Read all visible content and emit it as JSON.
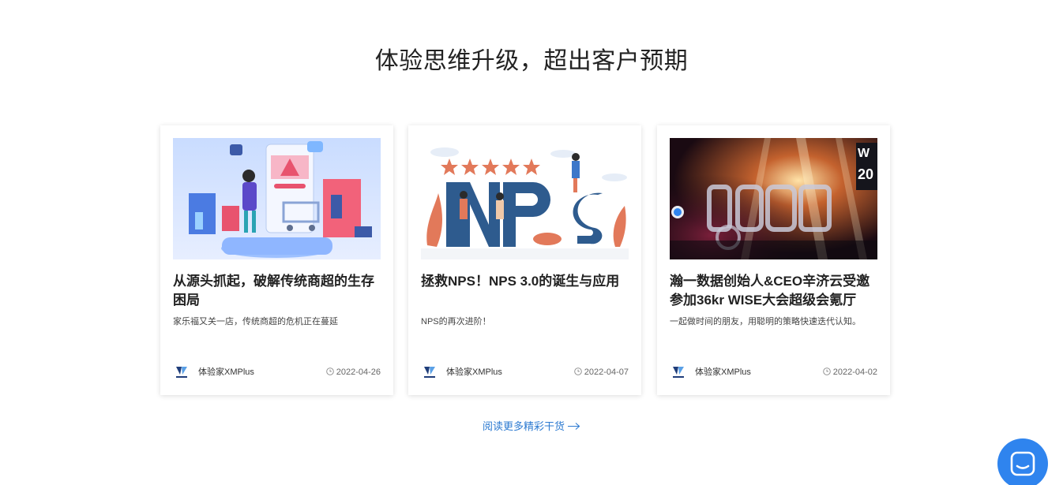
{
  "section": {
    "title": "体验思维升级，超出客户预期"
  },
  "articles": [
    {
      "title": "从源头抓起，破解传统商超的生存困局",
      "summary": "家乐福又关一店，传统商超的危机正在蔓延",
      "author": "体验家XMPlus",
      "date": "2022-04-26",
      "image": "shopping-illustration"
    },
    {
      "title": "拯救NPS！NPS 3.0的诞生与应用",
      "summary": "NPS的再次进阶！",
      "author": "体验家XMPlus",
      "date": "2022-04-07",
      "image": "nps-illustration"
    },
    {
      "title": "瀚一数据创始人&CEO辛济云受邀参加36kr WISE大会超级会氪厅",
      "summary": "一起做时间的朋友，用聪明的策略快速迭代认知。",
      "author": "体验家XMPlus",
      "date": "2022-04-02",
      "image": "stage-photo"
    }
  ],
  "footer": {
    "read_more": "阅读更多精彩干货"
  },
  "icons": {
    "clock": "clock-icon",
    "arrow": "arrow-right-icon",
    "chat": "chat-icon",
    "author_logo": "xmplus-logo"
  },
  "colors": {
    "link": "#2e7bd1",
    "chat_button": "#2f84ee"
  }
}
